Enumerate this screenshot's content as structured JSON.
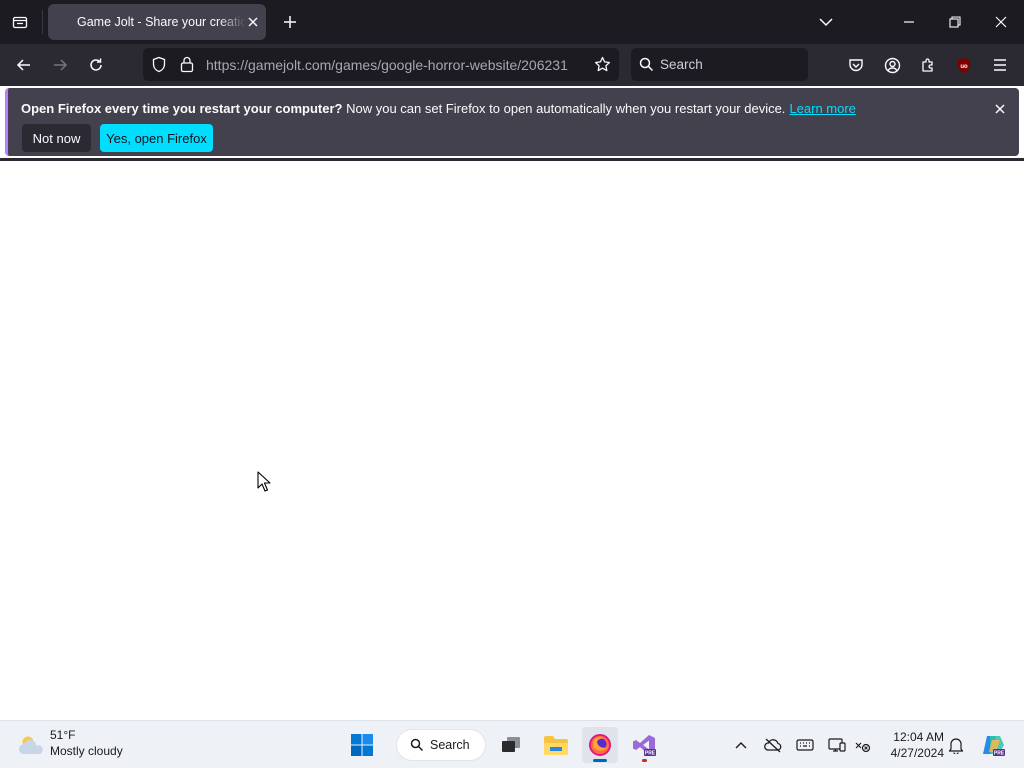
{
  "browser": {
    "tab": {
      "title": "Game Jolt - Share your creations"
    },
    "url": {
      "host": "https://gamejolt.com",
      "path": "/games/google-horror-website/206231"
    },
    "search": {
      "placeholder": "Search"
    }
  },
  "notification": {
    "bold": "Open Firefox every time you restart your computer?",
    "message": " Now you can set Firefox to open automatically when you restart your device.",
    "link": "Learn more",
    "not_now": "Not now",
    "yes": "Yes, open Firefox"
  },
  "taskbar": {
    "weather": {
      "temp": "51°F",
      "desc": "Mostly cloudy"
    },
    "search_label": "Search",
    "time": "12:04 AM",
    "date": "4/27/2024"
  },
  "colors": {
    "accent": "#00ddff",
    "chrome_dark": "#1c1b22",
    "toolbar": "#2b2a33",
    "notification_bg": "#42414d",
    "windows_blue": "#0067c0"
  }
}
